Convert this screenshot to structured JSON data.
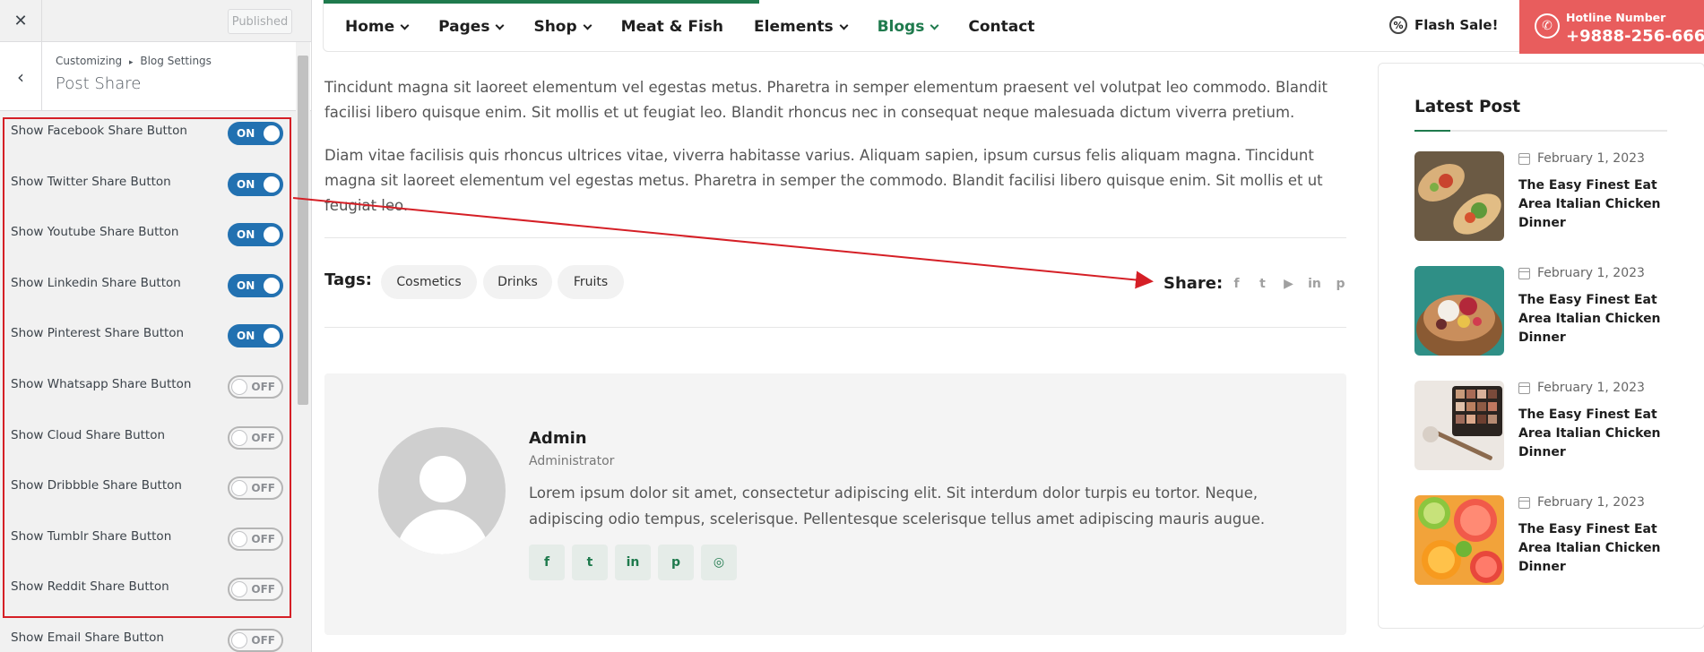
{
  "customizer": {
    "close_icon": "close-icon",
    "published_label": "Published",
    "back_icon": "chevron-left-icon",
    "breadcrumb_root": "Customizing",
    "breadcrumb_sep": "▸",
    "breadcrumb_section": "Blog Settings",
    "title": "Post Share",
    "toggles": [
      {
        "label": "Show Facebook Share Button",
        "state": "ON"
      },
      {
        "label": "Show Twitter Share Button",
        "state": "ON"
      },
      {
        "label": "Show Youtube Share Button",
        "state": "ON"
      },
      {
        "label": "Show Linkedin Share Button",
        "state": "ON"
      },
      {
        "label": "Show Pinterest Share Button",
        "state": "ON"
      },
      {
        "label": "Show Whatsapp Share Button",
        "state": "OFF"
      },
      {
        "label": "Show Cloud Share Button",
        "state": "OFF"
      },
      {
        "label": "Show Dribbble Share Button",
        "state": "OFF"
      },
      {
        "label": "Show Tumblr Share Button",
        "state": "OFF"
      },
      {
        "label": "Show Reddit Share Button",
        "state": "OFF"
      },
      {
        "label": "Show Email Share Button",
        "state": "OFF"
      }
    ]
  },
  "nav": {
    "items": [
      "Home",
      "Pages",
      "Shop",
      "Meat & Fish",
      "Elements",
      "Blogs",
      "Contact"
    ],
    "active": "Blogs",
    "flash_sale": "Flash Sale!",
    "hotline_label": "Hotline Number",
    "hotline_number": "+9888-256-666"
  },
  "article": {
    "paragraph_1": "Tincidunt magna sit laoreet elementum vel egestas metus. Pharetra in semper elementum praesent vel volutpat leo commodo. Blandit facilisi libero quisque enim. Sit mollis et ut feugiat leo. Blandit rhoncus nec in consequat neque malesuada dictum viverra pretium.",
    "paragraph_2": "Diam vitae facilisis quis rhoncus ultrices vitae, viverra habitasse varius. Aliquam sapien, ipsum cursus felis aliquam magna. Tincidunt magna sit laoreet elementum vel egestas metus. Pharetra in semper the commodo. Blandit facilisi libero quisque enim. Sit mollis et ut feugiat leo.",
    "tags_label": "Tags:",
    "tags": [
      "Cosmetics",
      "Drinks",
      "Fruits"
    ],
    "share_label": "Share:",
    "share_icons": [
      "facebook-icon",
      "twitter-icon",
      "youtube-icon",
      "linkedin-icon",
      "pinterest-icon"
    ]
  },
  "author": {
    "name": "Admin",
    "role": "Administrator",
    "bio": "Lorem ipsum dolor sit amet, consectetur adipiscing elit. Sit interdum dolor turpis eu tortor. Neque, adipiscing odio tempus, scelerisque. Pellentesque scelerisque tellus amet adipiscing mauris augue.",
    "social_icons": [
      "facebook-icon",
      "twitter-icon",
      "linkedin-icon",
      "pinterest-icon",
      "instagram-icon"
    ]
  },
  "sidebar": {
    "title": "Latest Post",
    "posts": [
      {
        "date": "February 1, 2023",
        "title": "The Easy Finest Eat Area Italian Chicken Dinner"
      },
      {
        "date": "February 1, 2023",
        "title": "The Easy Finest Eat Area Italian Chicken Dinner"
      },
      {
        "date": "February 1, 2023",
        "title": "The Easy Finest Eat Area Italian Chicken Dinner"
      },
      {
        "date": "February 1, 2023",
        "title": "The Easy Finest Eat Area Italian Chicken Dinner"
      }
    ]
  },
  "colors": {
    "brand_green": "#1f7a4d",
    "hotline_red": "#e85d5d",
    "toggle_on_blue": "#2271b1",
    "annotation_red": "#d51f26"
  }
}
